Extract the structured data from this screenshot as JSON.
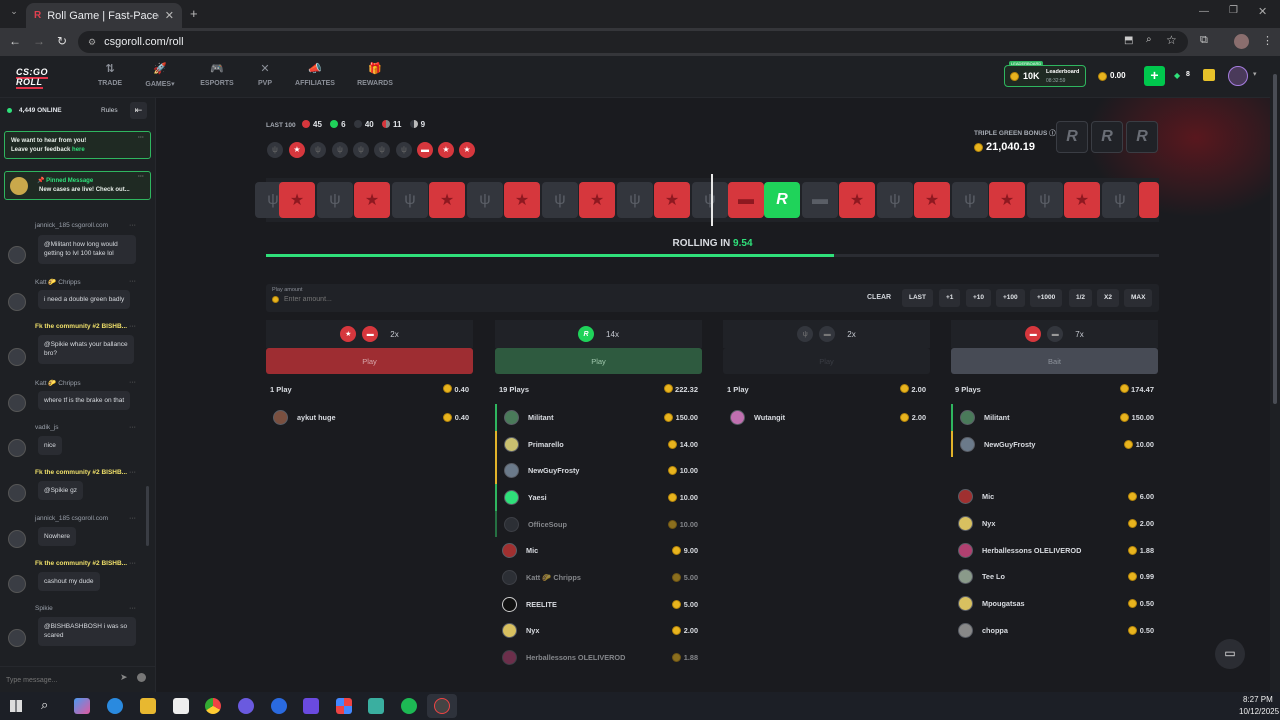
{
  "browser": {
    "tab_title": "Roll Game | Fast-Paced Tile Game",
    "url": "csgoroll.com/roll"
  },
  "header": {
    "logo": "CS:GO ROLL",
    "nav": [
      {
        "label": "TRADE",
        "icon": "trade-icon"
      },
      {
        "label": "GAMES",
        "icon": "games-icon"
      },
      {
        "label": "ESPORTS",
        "icon": "esports-icon"
      },
      {
        "label": "PVP",
        "icon": "pvp-icon"
      },
      {
        "label": "AFFILIATES",
        "icon": "affiliates-icon"
      },
      {
        "label": "REWARDS",
        "icon": "rewards-icon"
      }
    ],
    "leaderboard": {
      "tag": "LEADERBOARD",
      "amount": "10K",
      "label": "Leaderboard",
      "timer": "08:32:59"
    },
    "balance": "0.00",
    "gems": "8"
  },
  "chat": {
    "online": "4,449 ONLINE",
    "rules": "Rules",
    "feedback_line1": "We want to hear from you!",
    "feedback_line2": "Leave your feedback",
    "feedback_link": "here",
    "pinned_title": "Pinned Message",
    "pinned_text": "New cases are live! Check out...",
    "placeholder": "Type message...",
    "messages": [
      {
        "name": "jannick_185 csgoroll.com",
        "text": "@Militant how long would getting to lvl 100 take lol"
      },
      {
        "name": "Katt 🌮 Chripps",
        "text": "i need a double green badly"
      },
      {
        "name": "Fk the community #2 BISHB...",
        "text": "@Spikie whats your ballance bro?"
      },
      {
        "name": "Katt 🌮 Chripps",
        "text": "where tf is the brake on that"
      },
      {
        "name": "vadik_js",
        "text": "nice"
      },
      {
        "name": "Fk the community #2 BISHB...",
        "text": "@Spikie gz"
      },
      {
        "name": "jannick_185 csgoroll.com",
        "text": "Nowhere"
      },
      {
        "name": "Fk the community #2 BISHB...",
        "text": "cashout my dude"
      },
      {
        "name": "Spikie",
        "text": "@BISHBASHBOSH i was so scared"
      }
    ]
  },
  "game": {
    "last100_label": "LAST 100",
    "last100": {
      "red": "45",
      "green": "6",
      "black": "40",
      "red_bait": "11",
      "black_bait": "9"
    },
    "bonus_label": "TRIPLE GREEN BONUS",
    "bonus_amount": "21,040.19",
    "rolling_label": "ROLLING IN",
    "rolling_value": "9.54",
    "rolling_progress": 0.636,
    "play_amount_label": "Play amount",
    "play_amount_placeholder": "Enter amount...",
    "quick": [
      "CLEAR",
      "LAST",
      "+1",
      "+10",
      "+100",
      "+1000",
      "1/2",
      "X2",
      "MAX"
    ]
  },
  "columns": [
    {
      "multiplier": "2x",
      "button": "Play",
      "plays": "1 Play",
      "total": "0.40",
      "players": [
        {
          "name": "aykut huge",
          "amount": "0.40"
        }
      ]
    },
    {
      "multiplier": "14x",
      "button": "Play",
      "plays": "19 Plays",
      "total": "222.32",
      "players": [
        {
          "name": "Militant",
          "amount": "150.00"
        },
        {
          "name": "Primarello",
          "amount": "14.00"
        },
        {
          "name": "NewGuyFrosty",
          "amount": "10.00"
        },
        {
          "name": "Yaesi",
          "amount": "10.00"
        },
        {
          "name": "OfficeSoup",
          "amount": "10.00"
        },
        {
          "name": "Mic",
          "amount": "9.00"
        },
        {
          "name": "Katt 🌮 Chripps",
          "amount": "5.00"
        },
        {
          "name": "REELITE",
          "amount": "5.00"
        },
        {
          "name": "Nyx",
          "amount": "2.00"
        },
        {
          "name": "Herballessons OLELIVEROD",
          "amount": "1.88"
        }
      ]
    },
    {
      "multiplier": "2x",
      "button": "Play",
      "plays": "1 Play",
      "total": "2.00",
      "players": [
        {
          "name": "Wutangit",
          "amount": "2.00"
        }
      ]
    },
    {
      "multiplier": "7x",
      "button": "Bait",
      "plays": "9 Plays",
      "total": "174.47",
      "players": [
        {
          "name": "Militant",
          "amount": "150.00"
        },
        {
          "name": "NewGuyFrosty",
          "amount": "10.00"
        },
        {
          "name": "Mic",
          "amount": "6.00"
        },
        {
          "name": "Nyx",
          "amount": "2.00"
        },
        {
          "name": "Herballessons OLELIVEROD",
          "amount": "1.88"
        },
        {
          "name": "Tee Lo",
          "amount": "0.99"
        },
        {
          "name": "Mpougatsas",
          "amount": "0.50"
        },
        {
          "name": "choppa",
          "amount": "0.50"
        }
      ]
    }
  ],
  "taskbar": {
    "time": "8:27 PM",
    "date": "10/12/2025"
  },
  "colors": {
    "red": "#d6373d",
    "green": "#1fd35a",
    "black": "#33363d",
    "accent": "#00c74d"
  }
}
